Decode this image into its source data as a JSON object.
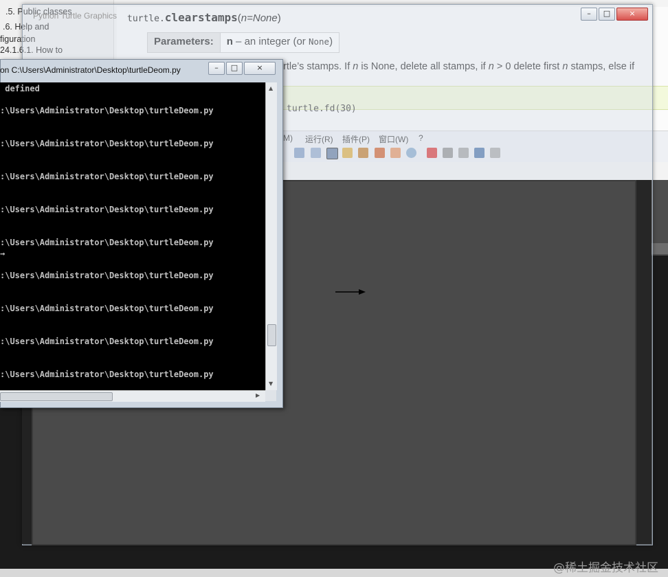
{
  "docs": {
    "nav": [
      ".5. Public classes",
      ".6. Help and",
      "figuration",
      "24.1.6.1. How to"
    ],
    "signature": {
      "module": "turtle.",
      "func": "clearstamps",
      "open": "(",
      "param": "n=None",
      "close": ")"
    },
    "params": {
      "label": "Parameters:",
      "name": "n",
      "dash": " – an integer (or ",
      "code": "None",
      "end": ")"
    },
    "desc_parts": [
      "rtle’s stamps. If ",
      "n",
      " is None, delete all stamps, if ",
      "n",
      " > 0 delete first ",
      "n",
      " stamps, else if"
    ],
    "code_line": "turtle.fd(30)"
  },
  "turtle_window": {
    "title": "Python Turtle Graphics",
    "buttons": [
      "–",
      "□",
      "×"
    ],
    "accent": "#d9534f"
  },
  "editor": {
    "menu": [
      "M)",
      "运行(R)",
      "插件(P)",
      "窗口(W)",
      "?"
    ]
  },
  "console": {
    "title": "on  C:\\Users\\Administrator\\Desktop\\turtleDeom.py",
    "buttons": [
      "–",
      "□",
      "×"
    ],
    "lines": [
      " defined",
      ":\\Users\\Administrator\\Desktop\\turtleDeom.py",
      ":\\Users\\Administrator\\Desktop\\turtleDeom.py",
      ":\\Users\\Administrator\\Desktop\\turtleDeom.py",
      ":\\Users\\Administrator\\Desktop\\turtleDeom.py",
      ":\\Users\\Administrator\\Desktop\\turtleDeom.py",
      "→",
      ":\\Users\\Administrator\\Desktop\\turtleDeom.py",
      ":\\Users\\Administrator\\Desktop\\turtleDeom.py",
      ":\\Users\\Administrator\\Desktop\\turtleDeom.py",
      ":\\Users\\Administrator\\Desktop\\turtleDeom.py"
    ]
  },
  "watermark": "@稀土掘金技术社区"
}
